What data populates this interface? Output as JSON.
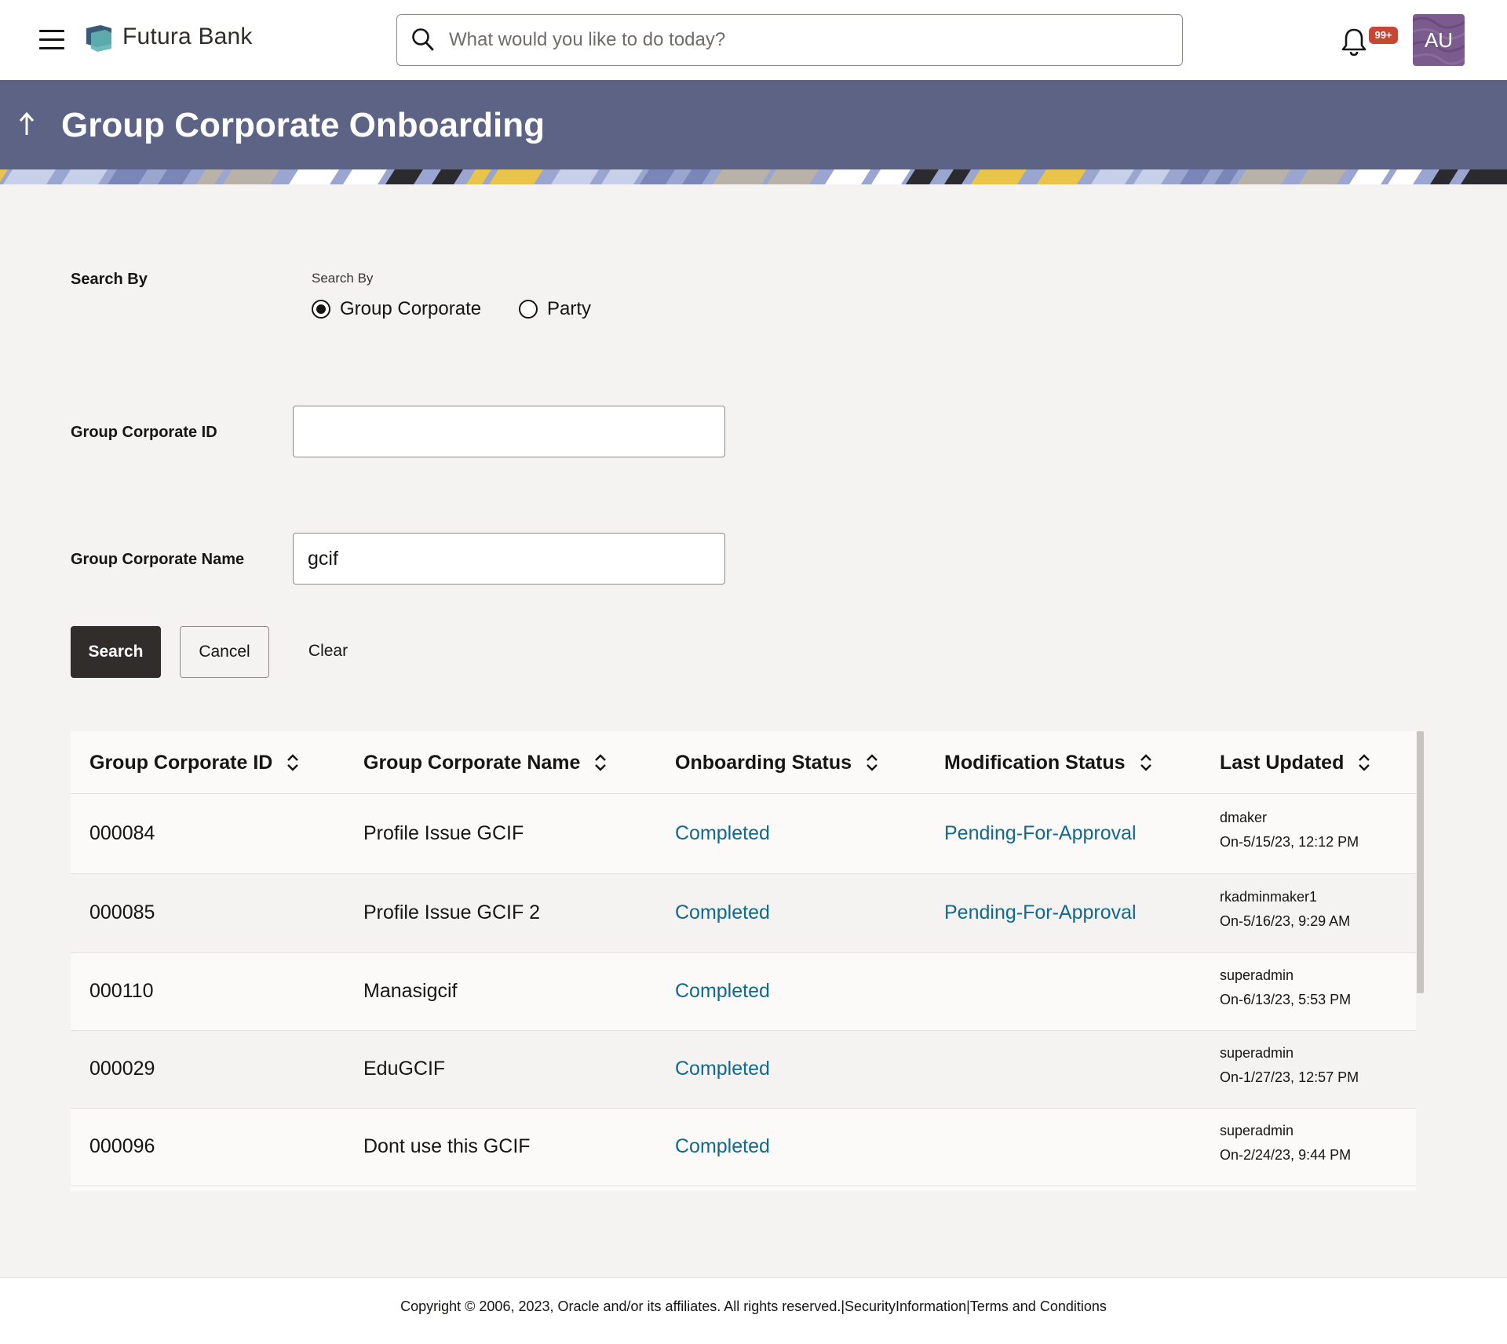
{
  "header": {
    "brand": "Futura Bank",
    "search_placeholder": "What would you like to do today?",
    "notification_count": "99+",
    "user_initials": "AU"
  },
  "page": {
    "title": "Group Corporate Onboarding"
  },
  "form": {
    "search_by_label": "Search By",
    "search_by_small_label": "Search By",
    "radio_options": [
      "Group Corporate",
      "Party"
    ],
    "radio_selected": "Group Corporate",
    "gcid_label": "Group Corporate ID",
    "gcid_value": "",
    "gcname_label": "Group Corporate Name",
    "gcname_value": "gcif",
    "search_button": "Search",
    "cancel_button": "Cancel",
    "clear_button": "Clear"
  },
  "table": {
    "columns": [
      "Group Corporate ID",
      "Group Corporate Name",
      "Onboarding Status",
      "Modification Status",
      "Last Updated"
    ],
    "rows": [
      {
        "id": "000084",
        "name": "Profile Issue GCIF",
        "onboarding": "Completed",
        "modification": "Pending-For-Approval",
        "user": "dmaker",
        "date": "On-5/15/23, 12:12 PM"
      },
      {
        "id": "000085",
        "name": "Profile Issue GCIF 2",
        "onboarding": "Completed",
        "modification": "Pending-For-Approval",
        "user": "rkadminmaker1",
        "date": "On-5/16/23, 9:29 AM"
      },
      {
        "id": "000110",
        "name": "Manasigcif",
        "onboarding": "Completed",
        "modification": "",
        "user": "superadmin",
        "date": "On-6/13/23, 5:53 PM"
      },
      {
        "id": "000029",
        "name": "EduGCIF",
        "onboarding": "Completed",
        "modification": "",
        "user": "superadmin",
        "date": "On-1/27/23, 12:57 PM"
      },
      {
        "id": "000096",
        "name": "Dont use this GCIF",
        "onboarding": "Completed",
        "modification": "",
        "user": "superadmin",
        "date": "On-2/24/23, 9:44 PM"
      }
    ]
  },
  "footer": {
    "copyright": "Copyright © 2006, 2023, Oracle and/or its affiliates. All rights reserved.",
    "sep1": "|",
    "security_link": "SecurityInformation",
    "sep2": "|",
    "terms_link": "Terms and Conditions"
  },
  "colors": {
    "banner": "#5c6384",
    "primary_button": "#312d2a",
    "link": "#0f6a8b",
    "badge": "#c74634",
    "avatar": "#7b5a8e"
  }
}
